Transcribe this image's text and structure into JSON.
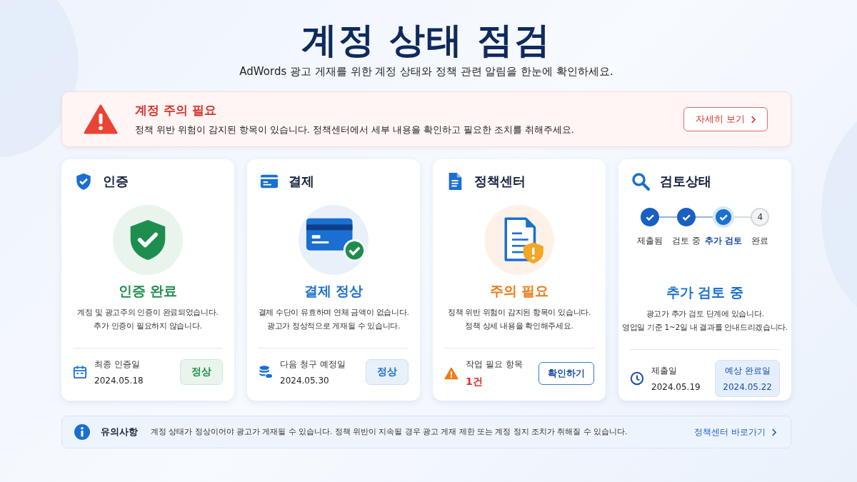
{
  "header": {
    "title": "계정 상태 점검",
    "subtitle": "AdWords 광고 게재를 위한 계정 상태와 정책 관련 알림을 한눈에 확인하세요."
  },
  "alert": {
    "title": "계정 주의 필요",
    "message": "정책 위반 위험이 감지된 항목이 있습니다. 정책센터에서 세부 내용을 확인하고 필요한 조치를 취해주세요.",
    "button": "자세히 보기"
  },
  "cards": [
    {
      "kind": "verify",
      "title": "인증",
      "status": "인증 완료",
      "color": "#1e8e4e",
      "description": [
        "계정 및 광고주의 인증이 완료되었습니다.",
        "추가 인증이 필요하지 않습니다."
      ],
      "footer": {
        "kind": "badge",
        "label": "최종 인증일",
        "value": "2024.05.18",
        "badge": "정상"
      }
    },
    {
      "kind": "billing",
      "title": "결제",
      "status": "결제 정상",
      "color": "#1a6fd1",
      "description": [
        "결제 수단이 유효하며 연체 금액이 없습니다.",
        "광고가 정상적으로 게재될 수 있습니다."
      ],
      "footer": {
        "kind": "badge",
        "label": "다음 청구 예정일",
        "value": "2024.05.30",
        "badge": "정상"
      }
    },
    {
      "kind": "policy",
      "title": "정책센터",
      "status": "주의 필요",
      "color": "#f07a16",
      "description": [
        "정책 위반 위험이 감지된 항목이 있습니다.",
        "정책 상세 내용을 확인해주세요."
      ],
      "footer": {
        "kind": "action",
        "label": "작업 필요 항목",
        "value": "1건",
        "button": "확인하기"
      }
    },
    {
      "kind": "review",
      "title": "검토상태",
      "status": "추가 검토 중",
      "color": "#1a6fd1",
      "steps": [
        {
          "label": "제출됨",
          "done": true,
          "selected": false
        },
        {
          "label": "검토 중",
          "done": true,
          "selected": false
        },
        {
          "label": "추가 검토",
          "done": true,
          "selected": true
        },
        {
          "label": "완료",
          "done": false,
          "selected": false,
          "number": "4"
        }
      ],
      "description": [
        "광고가 추가 검토 단계에 있습니다.",
        "영업일 기준 1~2일 내 결과를 안내드리겠습니다."
      ],
      "footer": {
        "kind": "estimate",
        "label": "제출일",
        "value": "2024.05.19",
        "estimate_label": "예상 완료일",
        "estimate_value": "2024.05.22"
      }
    }
  ],
  "notice": {
    "title": "유의사항",
    "message": "계정 상태가 정상이어야 광고가 게재될 수 있습니다. 정책 위반이 지속될 경우 광고 게재 제한 또는 계정 정지 조치가 취해질 수 있습니다.",
    "link": "정책센터 바로가기"
  }
}
